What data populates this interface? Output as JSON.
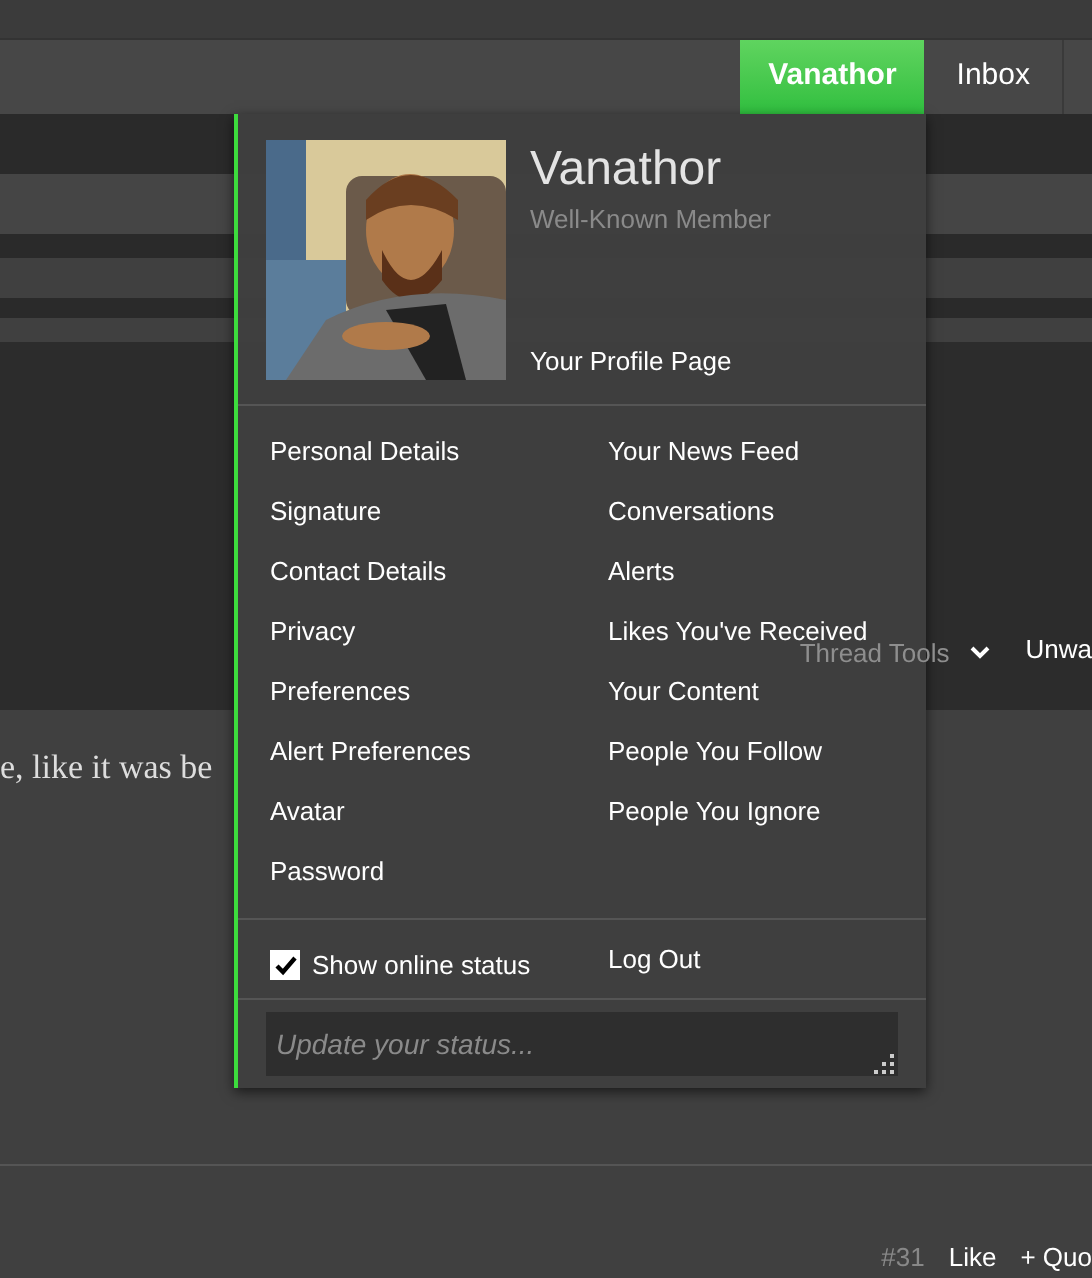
{
  "nav": {
    "tabs": [
      {
        "label": "Vanathor",
        "selected": true
      },
      {
        "label": "Inbox",
        "selected": false
      }
    ]
  },
  "page": {
    "thread_tools": "Thread Tools",
    "unwatch": "Unwa",
    "sentence": "e, like it was be",
    "post_number": "#31",
    "like": "Like",
    "quote": "+ Quo"
  },
  "popup": {
    "name": "Vanathor",
    "rank": "Well-Known Member",
    "profile_link": "Your Profile Page",
    "left_links": [
      "Personal Details",
      "Signature",
      "Contact Details",
      "Privacy",
      "Preferences",
      "Alert Preferences",
      "Avatar",
      "Password"
    ],
    "right_links": [
      "Your News Feed",
      "Conversations",
      "Alerts",
      "Likes You've Received",
      "Your Content",
      "People You Follow",
      "People You Ignore"
    ],
    "online_status": {
      "label": "Show online status",
      "checked": true
    },
    "logout": "Log Out",
    "status": {
      "placeholder": "Update your status..."
    }
  }
}
